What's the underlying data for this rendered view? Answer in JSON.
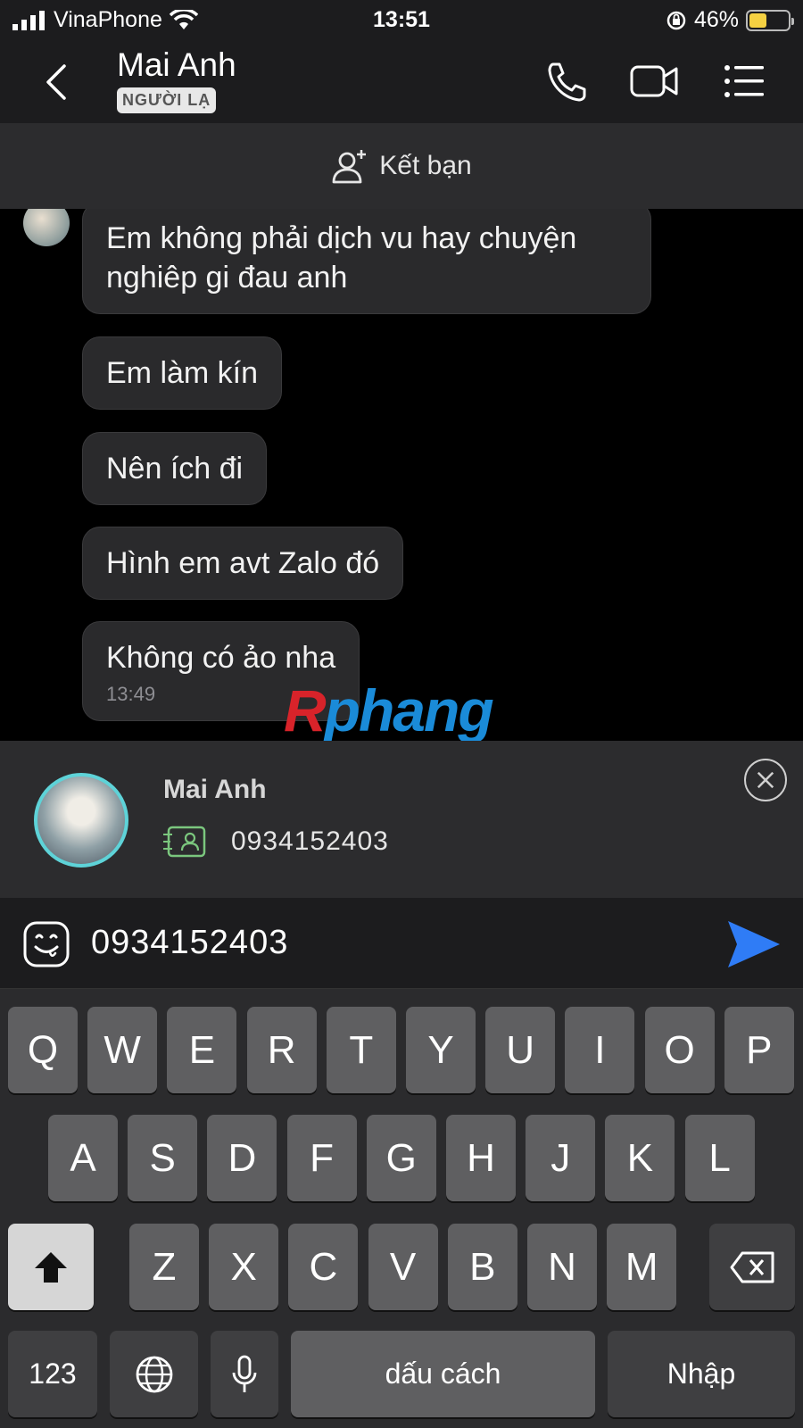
{
  "status": {
    "carrier": "VinaPhone",
    "time": "13:51",
    "battery_percent": "46%",
    "battery_level": 0.46,
    "battery_color": "#f5d142"
  },
  "header": {
    "title": "Mai Anh",
    "badge": "NGƯỜI LẠ",
    "icons": [
      "back-icon",
      "phone-icon",
      "video-icon",
      "menu-icon"
    ]
  },
  "friend_bar": {
    "label": "Kết bạn",
    "icon": "add-user-icon"
  },
  "messages": [
    {
      "text": "Em không phải dịch vu hay chuyện nghiêp gi đau anh"
    },
    {
      "text": "Em làm kín"
    },
    {
      "text": "Nên ích đi"
    },
    {
      "text": "Hình em avt Zalo đó"
    },
    {
      "text": "Không có ảo nha",
      "time": "13:49"
    }
  ],
  "watermark": {
    "part1": "R",
    "part2": "phang"
  },
  "suggestion": {
    "name": "Mai Anh",
    "phone": "0934152403",
    "accent": "#5ed3d8"
  },
  "composer": {
    "value": "0934152403",
    "send_color": "#2f7cf6"
  },
  "keyboard": {
    "row1": [
      "Q",
      "W",
      "E",
      "R",
      "T",
      "Y",
      "U",
      "I",
      "O",
      "P"
    ],
    "row2": [
      "A",
      "S",
      "D",
      "F",
      "G",
      "H",
      "J",
      "K",
      "L"
    ],
    "row3": [
      "Z",
      "X",
      "C",
      "V",
      "B",
      "N",
      "M"
    ],
    "numbers_key": "123",
    "space_key": "dấu cách",
    "return_key": "Nhập"
  }
}
